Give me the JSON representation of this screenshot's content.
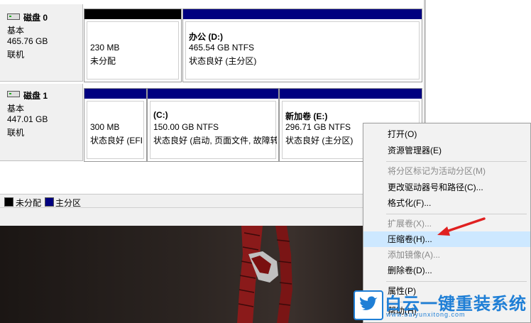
{
  "disks": [
    {
      "name": "磁盘 0",
      "type": "基本",
      "size": "465.76 GB",
      "status": "联机",
      "partitions": [
        {
          "label": "",
          "size": "230 MB",
          "status": "未分配",
          "kind": "unallocated"
        },
        {
          "label": "办公  (D:)",
          "size": "465.54 GB NTFS",
          "status": "状态良好 (主分区)",
          "kind": "primary"
        }
      ]
    },
    {
      "name": "磁盘 1",
      "type": "基本",
      "size": "447.01 GB",
      "status": "联机",
      "partitions": [
        {
          "label": "",
          "size": "300 MB",
          "status": "状态良好 (EFI",
          "kind": "primary"
        },
        {
          "label": "(C:)",
          "size": "150.00 GB NTFS",
          "status": "状态良好 (启动, 页面文件, 故障转",
          "kind": "primary"
        },
        {
          "label": "新加卷  (E:)",
          "size": "296.71 GB NTFS",
          "status": "状态良好 (主分区)",
          "kind": "primary-selected"
        }
      ]
    }
  ],
  "legend": {
    "unallocated": "未分配",
    "primary": "主分区"
  },
  "colors": {
    "unallocated": "#000000",
    "primary": "#000080",
    "menu_highlight": "#cde8ff",
    "arrow": "#e02020",
    "logo": "#1f7fd6"
  },
  "context_menu": {
    "items": [
      {
        "label": "打开(O)",
        "enabled": true
      },
      {
        "label": "资源管理器(E)",
        "enabled": true
      },
      {
        "label": "将分区标记为活动分区(M)",
        "enabled": false
      },
      {
        "label": "更改驱动器号和路径(C)...",
        "enabled": true
      },
      {
        "label": "格式化(F)...",
        "enabled": true
      },
      {
        "label": "扩展卷(X)...",
        "enabled": false
      },
      {
        "label": "压缩卷(H)...",
        "enabled": true,
        "highlighted": true
      },
      {
        "label": "添加镜像(A)...",
        "enabled": false
      },
      {
        "label": "删除卷(D)...",
        "enabled": true
      },
      {
        "label": "属性(P)",
        "enabled": true
      },
      {
        "label": "帮助(H)",
        "enabled": true
      }
    ]
  },
  "watermark": {
    "brand": "白云一键重装系统",
    "url": "www.baiyunxitong.com",
    "icon": "twitter-bird-icon"
  }
}
